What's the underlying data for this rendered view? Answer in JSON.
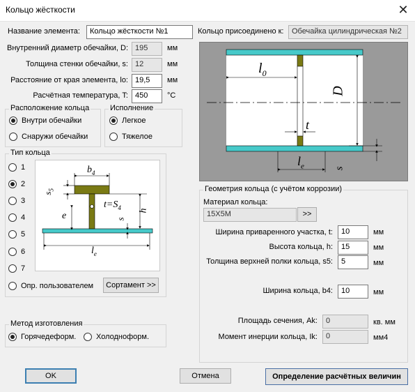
{
  "window": {
    "title": "Кольцо жёсткости",
    "close": "✕"
  },
  "element_name": {
    "label": "Название элемента:",
    "value": "Кольцо жёсткости №1"
  },
  "attached_to": {
    "label": "Кольцо присоединено к:",
    "value": "Обечайка цилиндрическая №2"
  },
  "inner_diameter": {
    "label": "Внутренний диаметр обечайки, D:",
    "value": "195",
    "unit": "мм"
  },
  "wall_thickness": {
    "label": "Толщина стенки обечайки, s:",
    "value": "12",
    "unit": "мм"
  },
  "edge_distance": {
    "label": "Расстояние от края элемента, lo:",
    "value": "19,5",
    "unit": "мм"
  },
  "design_temp": {
    "label": "Расчётная температура, T:",
    "value": "450",
    "unit": "°C"
  },
  "ring_location": {
    "title": "Расположение кольца",
    "inside": "Внутри обечайки",
    "outside": "Снаружи обечайки",
    "selected": "inside"
  },
  "execution": {
    "title": "Исполнение",
    "light": "Легкое",
    "heavy": "Тяжелое",
    "selected": "light"
  },
  "ring_type": {
    "title": "Тип кольца",
    "options": [
      "1",
      "2",
      "3",
      "4",
      "5",
      "6",
      "7"
    ],
    "selected": "2",
    "user_defined": "Опр. пользователем",
    "sortament_button": "Сортамент >>"
  },
  "type_sketch": {
    "b4": "b",
    "b4_sub": "4",
    "s5": "s",
    "s5_sub": "5",
    "t_eq": "t=S",
    "t_eq_sub": "4",
    "e": "e",
    "s": "s",
    "h": "h",
    "le": "l",
    "le_sub": "e"
  },
  "shell_sketch": {
    "l0": "l",
    "l0_sub": "0",
    "D": "D",
    "t": "t",
    "le": "l",
    "le_sub": "e",
    "s": "s"
  },
  "manufacturing": {
    "title": "Метод изготовления",
    "hot": "Горячедеформ.",
    "cold": "Холодноформ.",
    "selected": "hot"
  },
  "geometry": {
    "title": "Геометрия кольца (с учётом коррозии)",
    "material_label": "Материал кольца:",
    "material_value": "15Х5М",
    "material_button": ">>",
    "weld_width": {
      "label": "Ширина приваренного участка, t:",
      "value": "10",
      "unit": "мм"
    },
    "ring_height": {
      "label": "Высота кольца, h:",
      "value": "15",
      "unit": "мм"
    },
    "flange_thickness": {
      "label": "Толщина верхней полки кольца, s5:",
      "value": "5",
      "unit": "мм"
    },
    "ring_width": {
      "label": "Ширина кольца, b4:",
      "value": "10",
      "unit": "мм"
    },
    "area": {
      "label": "Площадь сечения, Ak:",
      "value": "0",
      "unit": "кв. мм"
    },
    "inertia": {
      "label": "Момент инерции кольца, Ik:",
      "value": "0",
      "unit": "мм4"
    }
  },
  "buttons": {
    "ok": "OK",
    "cancel": "Отмена",
    "calc": "Определение расчётных величин"
  }
}
